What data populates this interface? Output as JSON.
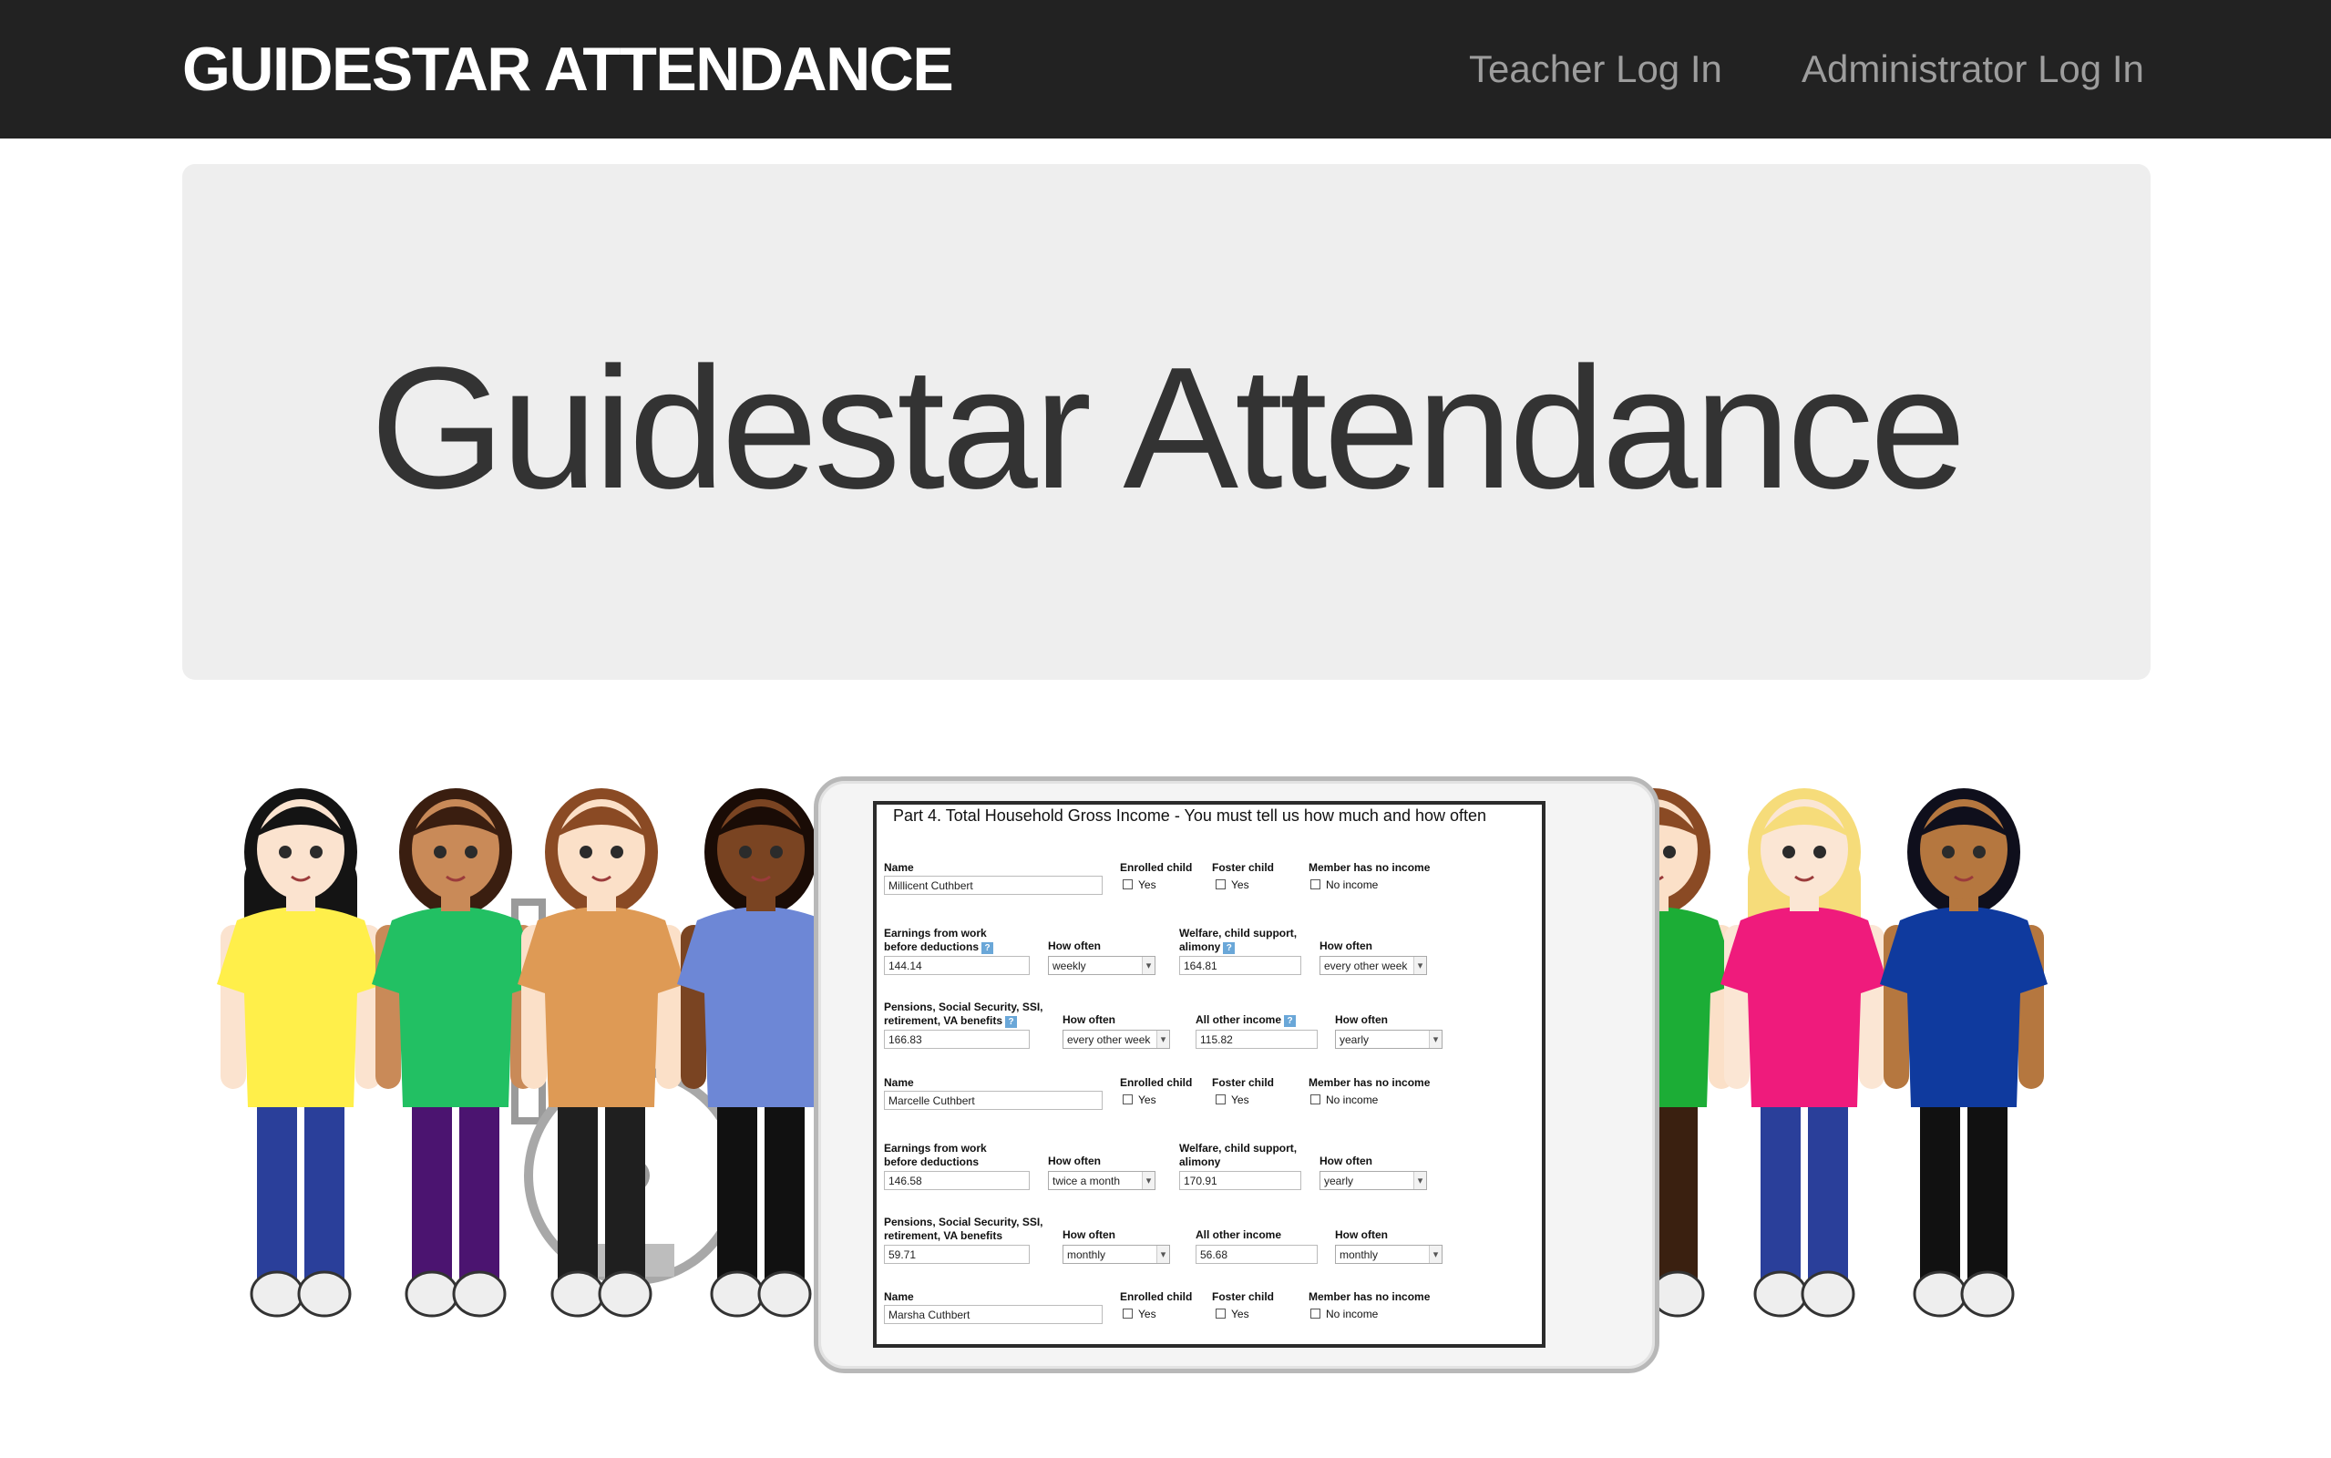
{
  "navbar": {
    "brand": "GUIDESTAR ATTENDANCE",
    "links": [
      "Teacher Log In",
      "Administrator Log In"
    ]
  },
  "jumbotron": {
    "heading": "Guidestar Attendance"
  },
  "hero": {
    "form": {
      "title": "Part 4. Total Household Gross Income - You must tell us how much and how often",
      "labels": {
        "name": "Name",
        "enrolled": "Enrolled child",
        "foster": "Foster child",
        "no_income_header": "Member has no income",
        "yes": "Yes",
        "no_income": "No income",
        "earnings": "Earnings from work\nbefore deductions",
        "how_often": "How often",
        "welfare": "Welfare, child support,\nalimony",
        "pensions": "Pensions, Social Security, SSI,\nretirement, VA benefits",
        "other": "All other income",
        "help": "?"
      },
      "members": [
        {
          "name": "Millicent Cuthbert",
          "earnings": "144.14",
          "earnings_freq": "weekly",
          "welfare": "164.81",
          "welfare_freq": "every other week",
          "pensions": "166.83",
          "pensions_freq": "every other week",
          "other": "115.82",
          "other_freq": "yearly"
        },
        {
          "name": "Marcelle Cuthbert",
          "earnings": "146.58",
          "earnings_freq": "twice a month",
          "welfare": "170.91",
          "welfare_freq": "yearly",
          "pensions": "59.71",
          "pensions_freq": "monthly",
          "other": "56.68",
          "other_freq": "monthly"
        },
        {
          "name": "Marsha Cuthbert"
        }
      ]
    },
    "characters": [
      {
        "shirt": "#ffef4a",
        "pants": "#2a3f9a",
        "skin": "#fbe3cf",
        "hair": "#141414"
      },
      {
        "shirt": "#22c063",
        "pants": "#4b1470",
        "skin": "#c98a58",
        "hair": "#3a1e10"
      },
      {
        "shirt": "#de9a55",
        "pants": "#1f1f1f",
        "skin": "#fbe0c8",
        "hair": "#8a4a24"
      },
      {
        "shirt": "#6d87d6",
        "pants": "#111111",
        "skin": "#7a4422",
        "hair": "#1a0c06"
      },
      {
        "shirt": "#b36ac6",
        "pants": "#167b86",
        "skin": "#fbe3cf",
        "hair": "#e8642c"
      },
      {
        "shirt": "#1cad36",
        "pants": "#3a2010",
        "skin": "#fbe0c8",
        "hair": "#8a4a24"
      },
      {
        "shirt": "#ef1b7c",
        "pants": "#2a3f9a",
        "skin": "#fbe6d4",
        "hair": "#f6dc7a"
      },
      {
        "shirt": "#0f3a9e",
        "pants": "#111111",
        "skin": "#b5773f",
        "hair": "#0f0f1c"
      }
    ]
  }
}
